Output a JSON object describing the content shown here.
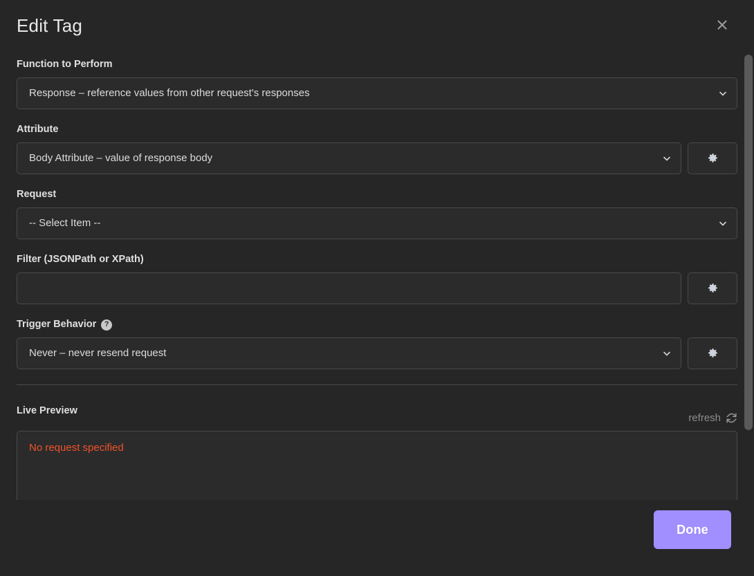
{
  "dialog": {
    "title": "Edit Tag",
    "close_icon": "close-icon"
  },
  "fields": {
    "function": {
      "label": "Function to Perform",
      "value": "Response – reference values from other request's responses",
      "chevron_icon": "chevron-down-icon"
    },
    "attribute": {
      "label": "Attribute",
      "value": "Body Attribute – value of response body",
      "chevron_icon": "chevron-down-icon",
      "gear_icon": "gear-icon"
    },
    "request": {
      "label": "Request",
      "value": "-- Select Item --",
      "chevron_icon": "chevron-down-icon"
    },
    "filter": {
      "label": "Filter (JSONPath or XPath)",
      "value": "",
      "placeholder": "",
      "gear_icon": "gear-icon"
    },
    "trigger_behavior": {
      "label": "Trigger Behavior",
      "help_icon": "help-icon",
      "help_glyph": "?",
      "value": "Never – never resend request",
      "chevron_icon": "chevron-down-icon",
      "gear_icon": "gear-icon"
    }
  },
  "live_preview": {
    "label": "Live Preview",
    "refresh_label": "refresh",
    "refresh_icon": "refresh-icon",
    "error_text": "No request specified"
  },
  "footer": {
    "done_label": "Done"
  },
  "colors": {
    "background": "#262626",
    "field_background": "#2b2b2b",
    "border": "#4a4a4a",
    "accent": "#a18fff",
    "error": "#f0512a",
    "muted_text": "#8d8d8d"
  }
}
